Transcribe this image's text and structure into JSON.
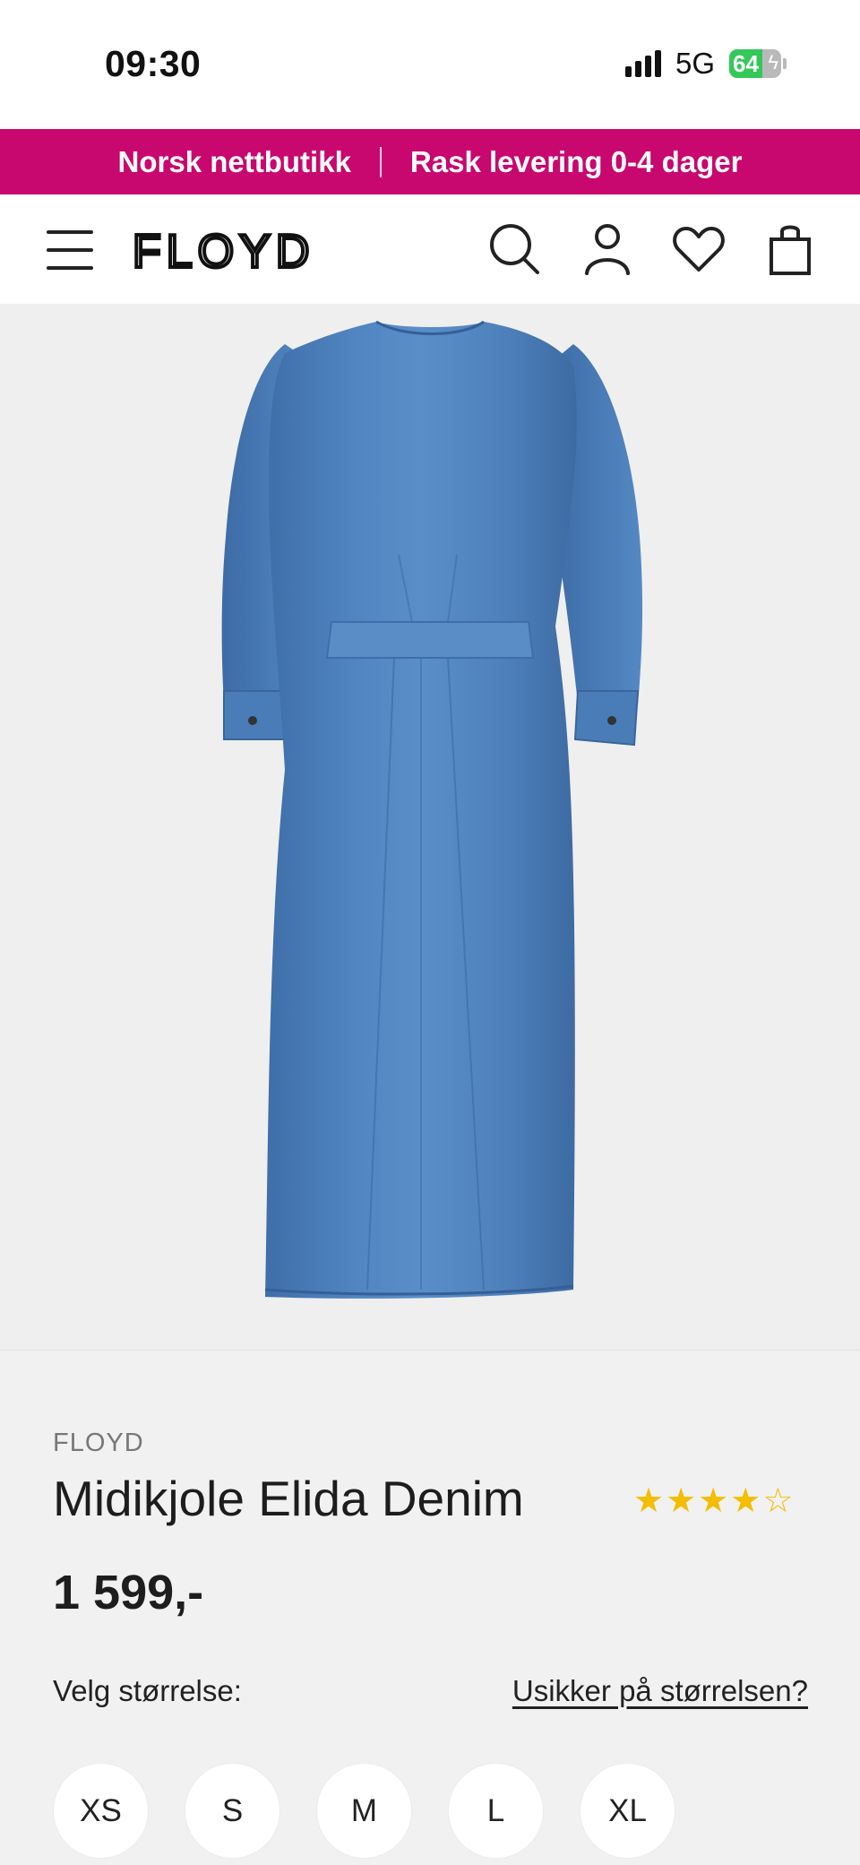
{
  "status_bar": {
    "time": "09:30",
    "network": "5G",
    "battery": "64",
    "battery_level": 0.64
  },
  "promo": {
    "left": "Norsk nettbutikk",
    "right": "Rask levering 0-4 dager"
  },
  "header": {
    "logo_text": "FLOYD",
    "icons": [
      "menu-icon",
      "search-icon",
      "account-icon",
      "heart-icon",
      "bag-icon"
    ]
  },
  "gallery": {
    "image_count": 6,
    "active_index": 5
  },
  "product": {
    "brand": "FLOYD",
    "title": "Midikjole Elida Denim",
    "rating": 4,
    "rating_max": 5,
    "price": "1 599,-",
    "size_label": "Velg størrelse:",
    "size_help": "Usikker på størrelsen?",
    "sizes": [
      "XS",
      "S",
      "M",
      "L",
      "XL"
    ]
  },
  "colors": {
    "accent": "#c8076f",
    "star": "#f5bd00",
    "denim": "#4f80bb"
  }
}
